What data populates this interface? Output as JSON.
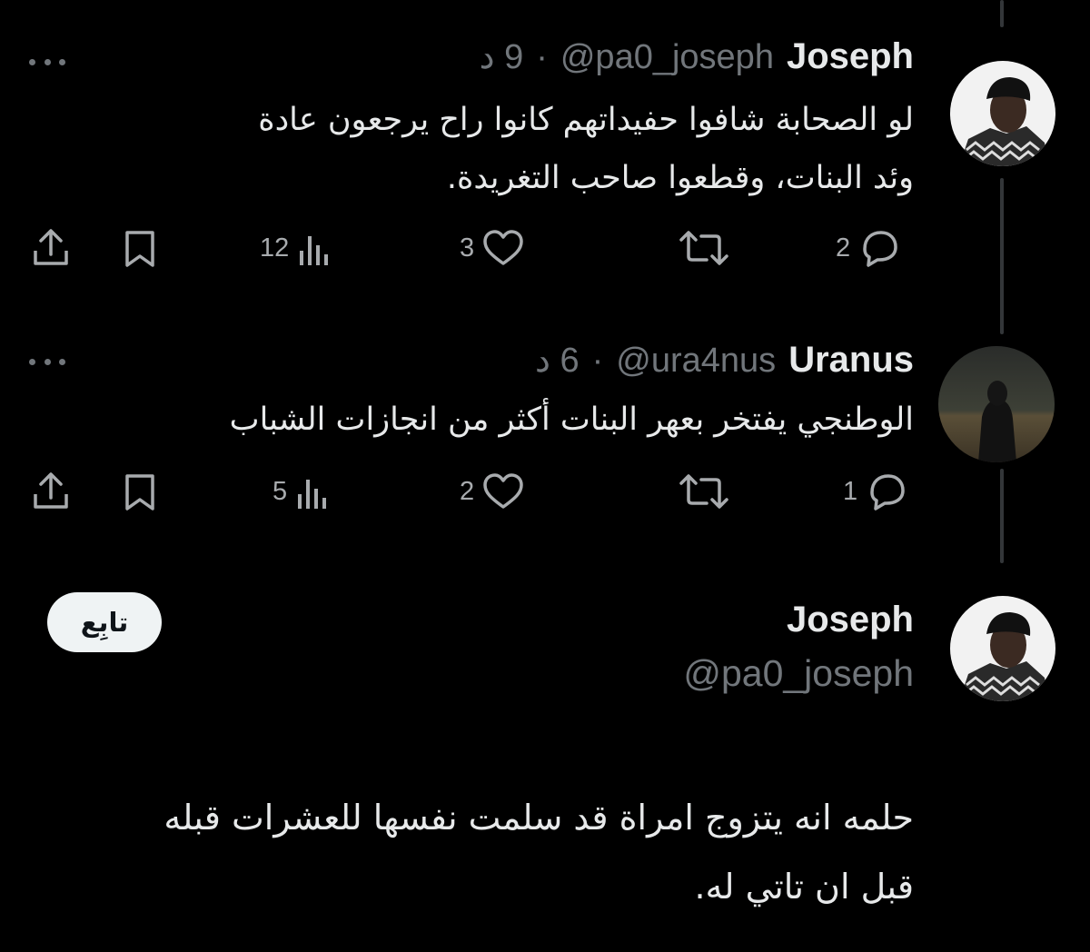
{
  "replies": [
    {
      "name": "Joseph",
      "handle": "@pa0_joseph",
      "separator": "·",
      "time": "9 د",
      "text_lines": [
        "لو الصحابة شافوا حفيداتهم كانوا راح يرجعون عادة",
        "وئد البنات، وقطعوا صاحب التغريدة."
      ],
      "replies_count": "2",
      "likes_count": "3",
      "views_count": "12",
      "avatar": "person-beanie-avatar"
    },
    {
      "name": "Uranus",
      "handle": "@ura4nus",
      "separator": "·",
      "time": "6 د",
      "text_lines": [
        "الوطنجي يفتخر بعهر البنات أكثر من انجازات الشباب"
      ],
      "replies_count": "1",
      "likes_count": "2",
      "views_count": "5",
      "avatar": "dark-figure-avatar"
    }
  ],
  "main_post": {
    "name": "Joseph",
    "handle": "@pa0_joseph",
    "follow_label": "تابِع",
    "text_lines": [
      "حلمه انه يتزوج امراة قد سلمت نفسها للعشرات قبله",
      "قبل ان تاتي له."
    ]
  },
  "icons": {
    "reply": "speech-bubble-icon",
    "repost": "repost-arrows-icon",
    "like": "heart-icon",
    "views": "bar-chart-icon",
    "bookmark": "bookmark-icon",
    "share": "share-upload-icon",
    "more": "more-dots-icon"
  },
  "colors": {
    "background": "#000000",
    "primary_text": "#e7e9ea",
    "secondary_text": "#71767b",
    "follow_button": "#eff3f4"
  }
}
